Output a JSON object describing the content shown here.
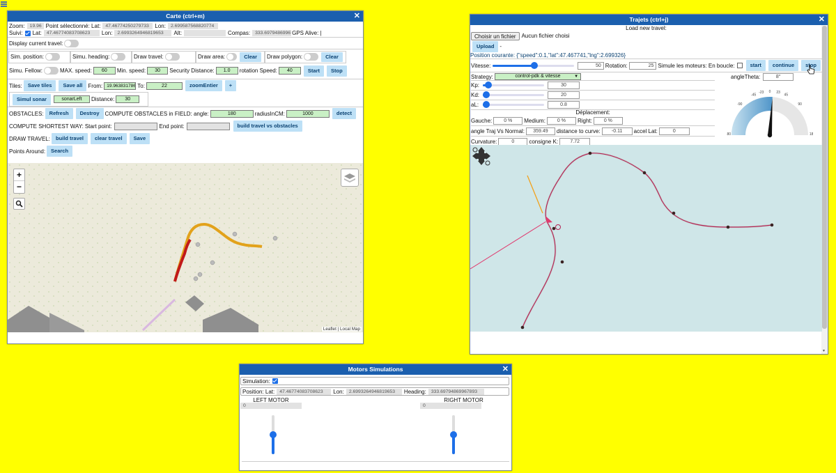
{
  "carte": {
    "title": "Carte (ctrl+m)",
    "zoom_label": "Zoom:",
    "zoom": "19.96",
    "point_label": "Point sélectionné: Lat:",
    "point_lat": "47.46774250279733",
    "lon_label": "Lon:",
    "point_lon": "2.699587568820774",
    "suivi_label": "Suivi:",
    "lat_label": "Lat:",
    "lat": "47.46774083708623",
    "lon2_label": "Lon:",
    "lon": "2.6993264946819653",
    "alt_label": "Alt:",
    "alt": "",
    "compas_label": "Compas:",
    "compas": "333.69794869967893",
    "gps_label": "GPS Alive: |",
    "display_travel": "Display current travel:",
    "sim_position": "Sim. position:",
    "simu_heading": "Simu. heading:",
    "draw_travel": "Draw travel:",
    "draw_area": "Draw area:",
    "clear": "Clear",
    "draw_polygon": "Draw polygon:",
    "clear2": "Clear",
    "simu_fellow": "Simu. Fellow:",
    "max_speed_label": "MAX. speed:",
    "max_speed": "60",
    "min_speed_label": "Min. speed:",
    "min_speed": "30",
    "security_label": "Security Distance:",
    "security": "1.0",
    "rotation_label": "rotation Speed:",
    "rotation": "40",
    "start": "Start",
    "stop": "Stop",
    "tiles_label": "Tiles:",
    "save_tiles": "Save tiles",
    "save_all": "Save all",
    "from_label": "From:",
    "from": "19.963831786",
    "to_label": "To:",
    "to": "22",
    "zoom_entier": "zoomEntier",
    "plus": "+",
    "simul_sonar": "Simul sonar",
    "sonar_value": "sonarLeft",
    "distance_label": "Distance:",
    "distance": "30",
    "obstacles_label": "OBSTACLES:",
    "refresh": "Refresh",
    "destroy": "Destroy",
    "compute_label": "COMPUTE OBSTACLES in FIELD: angle:",
    "angle": "180",
    "radius_label": "radiusInCM:",
    "radius": "1000",
    "detect": "detect",
    "shortest_label": "COMPUTE SHORTEST WAY:",
    "start_point_label": "Start point:",
    "end_point_label": "End point:",
    "build_travel_obstacles": "build travel vs obstacles",
    "draw_travel_label": "DRAW TRAVEL:",
    "build_travel": "build travel",
    "clear_travel": "clear travel",
    "save": "Save",
    "points_around_label": "Points Around:",
    "search": "Search",
    "zoom_in": "+",
    "zoom_out": "−",
    "attribution": "Leaflet | Local Map"
  },
  "trajets": {
    "title": "Trajets (ctrl+j)",
    "load_new": "Load new travel:",
    "choose_file": "Choisir un fichier",
    "no_file": "Aucun fichier choisi",
    "upload": "Upload",
    "dash": "-",
    "position_courante": "Position courante: {\"speed\":0.1,\"lat\":47.467741,\"lng\":2.699326}",
    "vitesse_label": "Vitesse:",
    "vitesse": "50",
    "rotation_label": "Rotation:",
    "rotation": "25",
    "simule_label": "Simule les moteurs: En boucle:",
    "start": "start",
    "continue": "continue",
    "stop": "stop",
    "strategy_label": "Strategy:",
    "strategy": "control-pdk & vitesse",
    "kp_label": "Kp:",
    "kp": "30",
    "kd_label": "Kd:",
    "kd": "20",
    "al_label": "aL:",
    "al": "0.8",
    "angle_theta_label": "angleTheta:",
    "angle_theta": "8°",
    "deplacement": "Déplacement:",
    "gauche_label": "Gauche:",
    "gauche": "0 %",
    "medium_label": "Medium:",
    "medium": "0 %",
    "right_label": "Right:",
    "right": "0 %",
    "angle_traj_label": "angle Traj Vs Normal:",
    "angle_traj": "359.49",
    "dist_curve_label": "distance to curve:",
    "dist_curve": "-0.11",
    "accel_label": "accel Lat:",
    "accel": "0",
    "curvature_label": "Curvature:",
    "curvature": "0",
    "consigne_label": "consigne K:",
    "consigne": "7.72",
    "gauge_ticks": [
      "-180",
      "-90",
      "-45",
      "-23",
      "0",
      "23",
      "45",
      "90",
      "180"
    ],
    "gauge_value": 8
  },
  "motors": {
    "title": "Motors Simulations",
    "simulation_label": "Simulation:",
    "position_label": "Position: Lat:",
    "lat": "47.46774083708623",
    "lon_label": "Lon:",
    "lon": "2.6993264946819653",
    "heading_label": "Heading:",
    "heading": "333.69794869967893",
    "left_motor": "LEFT MOTOR",
    "left_value": "0",
    "right_motor": "RIGHT MOTOR",
    "right_value": "0"
  },
  "colors": {
    "accent": "#1b5fae",
    "background": "#ffff00",
    "button": "#bde0f6",
    "input_green": "#c9f0c5"
  }
}
